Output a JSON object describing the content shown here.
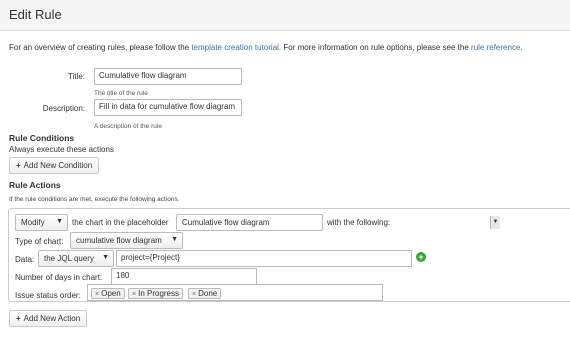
{
  "header": {
    "title": "Edit Rule"
  },
  "intro": {
    "prefix": "For an overview of creating rules, please follow the ",
    "tutorial_link": "template creation tutorial",
    "middle": ". For more information on rule options, please see the ",
    "reference_link": "rule reference",
    "suffix": "."
  },
  "form": {
    "title_label": "Title:",
    "title_value": "Cumulative flow diagram",
    "title_hint": "The title of the rule",
    "description_label": "Description:",
    "description_value": "Fill in data for cumulative flow diagram",
    "description_hint": "A description of the rule"
  },
  "conditions": {
    "heading": "Rule Conditions",
    "text": "Always execute these actions",
    "add_button": "Add New Condition"
  },
  "actions": {
    "heading": "Rule Actions",
    "text": "If the rule conditions are met, execute the following actions.",
    "action_select": "Modify",
    "chart_text": "the chart in the placeholder",
    "placeholder_select": "Cumulative flow diagram",
    "following_text": "with the following:",
    "type_label": "Type of chart:",
    "type_select": "cumulative flow diagram",
    "data_label": "Data:",
    "data_select": "the JQL query",
    "data_value": "project={Project}",
    "days_label": "Number of days in chart:",
    "days_value": "180",
    "status_label": "Issue status order:",
    "status_tags": [
      "Open",
      "In Progress",
      "Done"
    ],
    "add_button": "Add New Action"
  },
  "icons": {
    "dropdown": "chevron-down-icon",
    "plus": "plus-icon",
    "remove": "remove-x-icon",
    "add_green": "add-circle-icon"
  },
  "colors": {
    "link": "#3b73af",
    "add_green": "#3aa33a"
  }
}
